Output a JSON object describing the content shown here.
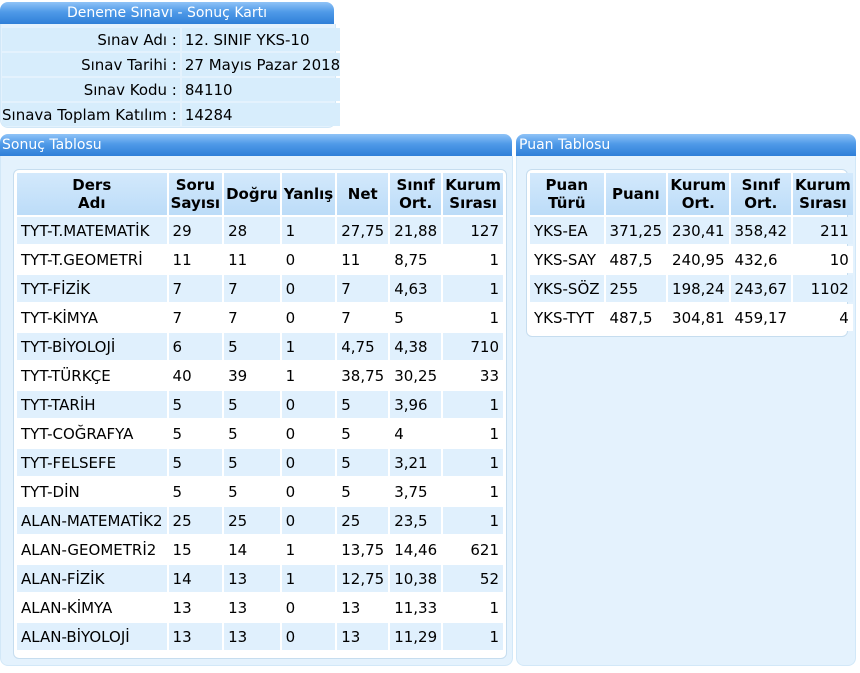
{
  "card": {
    "title": "Deneme Sınavı - Sonuç Kartı",
    "rows": [
      {
        "label": "Sınav Adı :",
        "value": "12. SINIF YKS-10"
      },
      {
        "label": "Sınav Tarihi :",
        "value": "27 Mayıs Pazar 2018"
      },
      {
        "label": "Sınav Kodu :",
        "value": "84110"
      },
      {
        "label": "Sınava Toplam Katılım :",
        "value": "14284"
      }
    ]
  },
  "results": {
    "title": "Sonuç Tablosu",
    "headers": [
      "Ders\nAdı",
      "Soru\nSayısı",
      "Doğru",
      "Yanlış",
      "Net",
      "Sınıf\nOrt.",
      "Kurum\nSırası"
    ],
    "rows": [
      [
        "TYT-T.MATEMATİK",
        "29",
        "28",
        "1",
        "27,75",
        "21,88",
        "127"
      ],
      [
        "TYT-T.GEOMETRİ",
        "11",
        "11",
        "0",
        "11",
        "8,75",
        "1"
      ],
      [
        "TYT-FİZİK",
        "7",
        "7",
        "0",
        "7",
        "4,63",
        "1"
      ],
      [
        "TYT-KİMYA",
        "7",
        "7",
        "0",
        "7",
        "5",
        "1"
      ],
      [
        "TYT-BİYOLOJİ",
        "6",
        "5",
        "1",
        "4,75",
        "4,38",
        "710"
      ],
      [
        "TYT-TÜRKÇE",
        "40",
        "39",
        "1",
        "38,75",
        "30,25",
        "33"
      ],
      [
        "TYT-TARİH",
        "5",
        "5",
        "0",
        "5",
        "3,96",
        "1"
      ],
      [
        "TYT-COĞRAFYA",
        "5",
        "5",
        "0",
        "5",
        "4",
        "1"
      ],
      [
        "TYT-FELSEFE",
        "5",
        "5",
        "0",
        "5",
        "3,21",
        "1"
      ],
      [
        "TYT-DİN",
        "5",
        "5",
        "0",
        "5",
        "3,75",
        "1"
      ],
      [
        "ALAN-MATEMATİK2",
        "25",
        "25",
        "0",
        "25",
        "23,5",
        "1"
      ],
      [
        "ALAN-GEOMETRİ2",
        "15",
        "14",
        "1",
        "13,75",
        "14,46",
        "621"
      ],
      [
        "ALAN-FİZİK",
        "14",
        "13",
        "1",
        "12,75",
        "10,38",
        "52"
      ],
      [
        "ALAN-KİMYA",
        "13",
        "13",
        "0",
        "13",
        "11,33",
        "1"
      ],
      [
        "ALAN-BİYOLOJİ",
        "13",
        "13",
        "0",
        "13",
        "11,29",
        "1"
      ]
    ]
  },
  "scores": {
    "title": "Puan Tablosu",
    "headers": [
      "Puan\nTürü",
      "Puanı",
      "Kurum\nOrt.",
      "Sınıf\nOrt.",
      "Kurum\nSırası"
    ],
    "rows": [
      [
        "YKS-EA",
        "371,25",
        "230,41",
        "358,42",
        "211"
      ],
      [
        "YKS-SAY",
        "487,5",
        "240,95",
        "432,6",
        "10"
      ],
      [
        "YKS-SÖZ",
        "255",
        "198,24",
        "243,67",
        "1102"
      ],
      [
        "YKS-TYT",
        "487,5",
        "304,81",
        "459,17",
        "4"
      ]
    ]
  }
}
